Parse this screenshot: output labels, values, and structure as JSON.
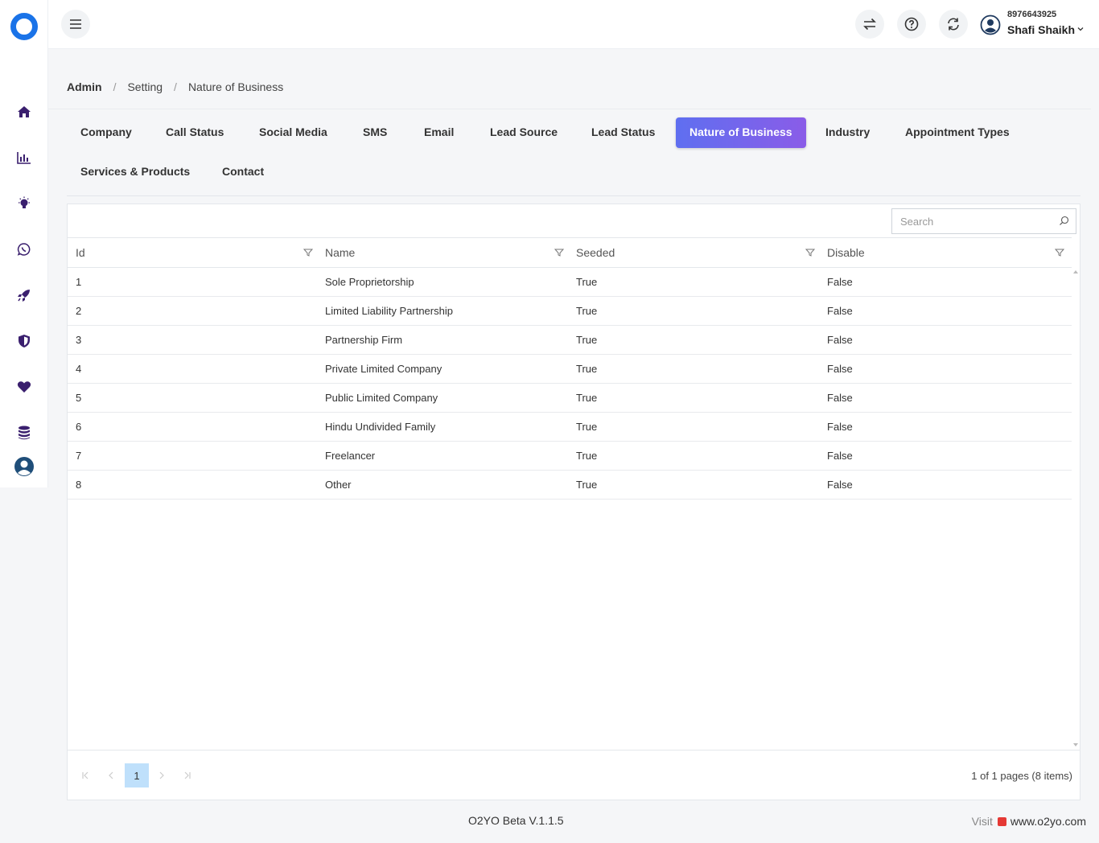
{
  "header": {
    "user_phone": "8976643925",
    "user_name": "Shafi Shaikh"
  },
  "breadcrumb": {
    "root": "Admin",
    "parent": "Setting",
    "current": "Nature of Business",
    "separator": "/"
  },
  "tabs": [
    {
      "label": "Company"
    },
    {
      "label": "Call Status"
    },
    {
      "label": "Social Media"
    },
    {
      "label": "SMS"
    },
    {
      "label": "Email"
    },
    {
      "label": "Lead Source"
    },
    {
      "label": "Lead Status"
    },
    {
      "label": "Nature of Business",
      "active": true
    },
    {
      "label": "Industry"
    },
    {
      "label": "Appointment Types"
    },
    {
      "label": "Services & Products"
    },
    {
      "label": "Contact"
    }
  ],
  "grid": {
    "search_placeholder": "Search",
    "columns": [
      "Id",
      "Name",
      "Seeded",
      "Disable"
    ],
    "rows": [
      [
        "1",
        "Sole Proprietorship",
        "True",
        "False"
      ],
      [
        "2",
        "Limited Liability Partnership",
        "True",
        "False"
      ],
      [
        "3",
        "Partnership Firm",
        "True",
        "False"
      ],
      [
        "4",
        "Private Limited Company",
        "True",
        "False"
      ],
      [
        "5",
        "Public Limited Company",
        "True",
        "False"
      ],
      [
        "6",
        "Hindu Undivided Family",
        "True",
        "False"
      ],
      [
        "7",
        "Freelancer",
        "True",
        "False"
      ],
      [
        "8",
        "Other",
        "True",
        "False"
      ]
    ],
    "pager": {
      "current_page": "1",
      "info": "1 of 1 pages (8 items)"
    }
  },
  "footer": {
    "version": "O2YO Beta V.1.1.5",
    "visit_label": "Visit",
    "visit_url": "www.o2yo.com"
  },
  "colors": {
    "accent": "#5f6ff0",
    "accent_end": "#8a5ce8",
    "sidebar_icon": "#3a1f6e",
    "logo": "#1a73e8",
    "page_selected": "#bfe0fb"
  },
  "icons": {
    "sidebar": [
      "home-icon",
      "bar-chart-icon",
      "lightbulb-icon",
      "whatsapp-icon",
      "rocket-icon",
      "shield-icon",
      "heart-icon",
      "database-icon",
      "user-circle-icon"
    ],
    "header": [
      "hamburger-icon",
      "swap-icon",
      "help-icon",
      "refresh-icon",
      "user-avatar-icon",
      "chevron-down-icon"
    ]
  }
}
